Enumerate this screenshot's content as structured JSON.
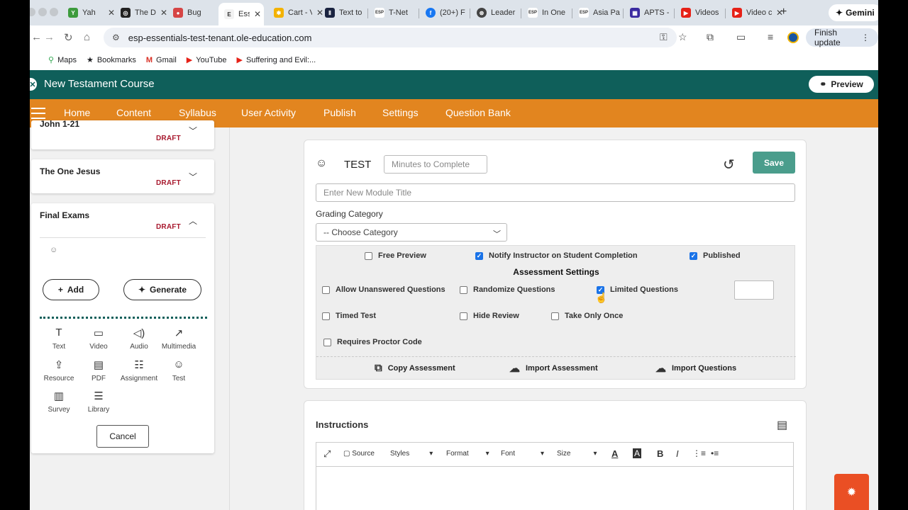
{
  "browser": {
    "tabs": [
      {
        "label": "Yah",
        "fav_color": "#3d9b3d"
      },
      {
        "label": "The Div",
        "fav_color": "#222222"
      },
      {
        "label": "Bug",
        "fav_color": "#d64545"
      },
      {
        "label": "Ess",
        "fav_color": "#ffffff",
        "active": true
      },
      {
        "label": "Cart - V",
        "fav_color": "#f3b200"
      },
      {
        "label": "Text to",
        "fav_color": "#1a2340"
      },
      {
        "label": "T-Net",
        "fav_color": "#ffffff"
      },
      {
        "label": "(20+) F",
        "fav_color": "#1877f2"
      },
      {
        "label": "Leader",
        "fav_color": "#444444"
      },
      {
        "label": "In One",
        "fav_color": "#ffffff"
      },
      {
        "label": "Asia Pa",
        "fav_color": "#ffffff"
      },
      {
        "label": "APTS -",
        "fav_color": "#3a2aa0"
      },
      {
        "label": "Videos",
        "fav_color": "#e62117"
      },
      {
        "label": "Video c",
        "fav_color": "#e62117"
      }
    ],
    "gemini_label": "Gemini",
    "url": "esp-essentials-test-tenant.ole-education.com",
    "finish_update": "Finish update",
    "bookmarks": [
      {
        "label": "Maps",
        "icon": "map-pin-icon"
      },
      {
        "label": "Bookmarks",
        "icon": "star-icon"
      },
      {
        "label": "Gmail",
        "icon": "gmail-icon"
      },
      {
        "label": "YouTube",
        "icon": "youtube-icon"
      },
      {
        "label": "Suffering and Evil:...",
        "icon": "youtube-icon"
      }
    ]
  },
  "header": {
    "course_title": "New Testament Course",
    "preview_label": "Preview"
  },
  "nav": {
    "items": [
      "Home",
      "Content",
      "Syllabus",
      "User Activity",
      "Publish",
      "Settings",
      "Question Bank"
    ],
    "active": "Content"
  },
  "sidebar": {
    "modules": [
      {
        "title": "John 1-21",
        "status": "DRAFT"
      },
      {
        "title": "The One Jesus",
        "status": "DRAFT"
      },
      {
        "title": "Final Exams",
        "status": "DRAFT"
      }
    ],
    "add_label": "Add",
    "generate_label": "Generate",
    "tools": [
      "Text",
      "Video",
      "Audio",
      "Multimedia",
      "Resource",
      "PDF",
      "Assignment",
      "Test",
      "Survey",
      "Library"
    ],
    "cancel_label": "Cancel"
  },
  "editor": {
    "type_label": "TEST",
    "minutes_placeholder": "Minutes to Complete",
    "save_label": "Save",
    "title_placeholder": "Enter New Module Title",
    "grading_label": "Grading Category",
    "category_value": "-- Choose Category",
    "options": {
      "free_preview": {
        "label": "Free Preview",
        "checked": false
      },
      "notify_instructor": {
        "label": "Notify Instructor on Student Completion",
        "checked": true
      },
      "published": {
        "label": "Published",
        "checked": true
      }
    },
    "assessment_title": "Assessment Settings",
    "assessment": {
      "allow_unanswered": {
        "label": "Allow Unanswered Questions",
        "checked": false
      },
      "randomize": {
        "label": "Randomize Questions",
        "checked": false
      },
      "limited": {
        "label": "Limited Questions",
        "checked": true
      },
      "timed": {
        "label": "Timed Test",
        "checked": false
      },
      "hide_review": {
        "label": "Hide Review",
        "checked": false
      },
      "take_once": {
        "label": "Take Only Once",
        "checked": false
      },
      "proctor": {
        "label": "Requires Proctor Code",
        "checked": false
      }
    },
    "actions": {
      "copy": "Copy Assessment",
      "import_assessment": "Import Assessment",
      "import_questions": "Import Questions"
    }
  },
  "instructions": {
    "title": "Instructions",
    "toolbar": {
      "source": "Source",
      "styles": "Styles",
      "format": "Format",
      "font": "Font",
      "size": "Size"
    }
  }
}
